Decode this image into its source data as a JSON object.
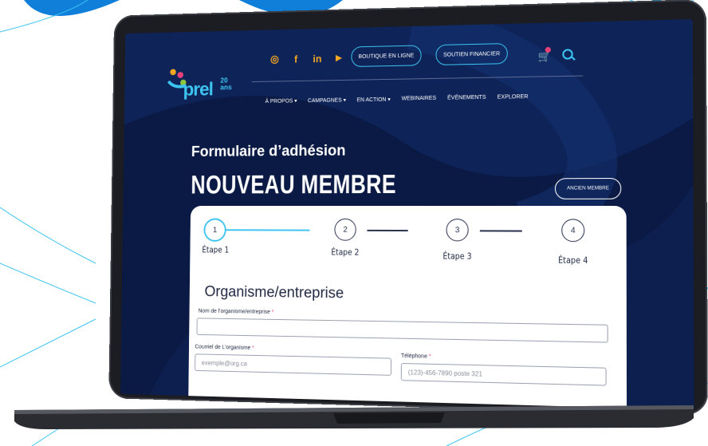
{
  "site": {
    "logo_text": "prel",
    "logo_years_1": "20",
    "logo_years_2": "ans"
  },
  "social_icons": [
    "instagram-icon",
    "facebook-icon",
    "linkedin-icon",
    "youtube-icon"
  ],
  "header_buttons": {
    "boutique": "BOUTIQUE EN LIGNE",
    "soutien": "SOUTIEN FINANCIER"
  },
  "nav": {
    "items": [
      {
        "label": "À PROPOS",
        "dropdown": true
      },
      {
        "label": "CAMPAGNES",
        "dropdown": true
      },
      {
        "label": "EN ACTION",
        "dropdown": true
      },
      {
        "label": "WEBINAIRES",
        "dropdown": false
      },
      {
        "label": "ÉVÉNEMENTS",
        "dropdown": false
      },
      {
        "label": "EXPLORER",
        "dropdown": false
      }
    ]
  },
  "page": {
    "kicker": "Formulaire d’adhésion",
    "title": "NOUVEAU MEMBRE",
    "ancien_button": "ANCIEN MEMBRE"
  },
  "stepper": {
    "active_step": 1,
    "steps": [
      {
        "number": "1",
        "label": "Étape 1"
      },
      {
        "number": "2",
        "label": "Étape 2"
      },
      {
        "number": "3",
        "label": "Étape 3"
      },
      {
        "number": "4",
        "label": "Étape 4"
      }
    ]
  },
  "form": {
    "section_title": "Organisme/entreprise",
    "org_name_label": "Nom de l’organisme/entreprise",
    "org_email_label": "Courriel de L’organisme",
    "org_email_placeholder": "exemple@org.ca",
    "phone_label": "Téléphone",
    "phone_placeholder": "(123)-456-7890 poste 321",
    "required_marker": "*"
  },
  "colors": {
    "brand_blue": "#0a1a44",
    "accent_cyan": "#3dc4f0",
    "accent_orange": "#f5a623",
    "required_pink": "#e8417a"
  }
}
